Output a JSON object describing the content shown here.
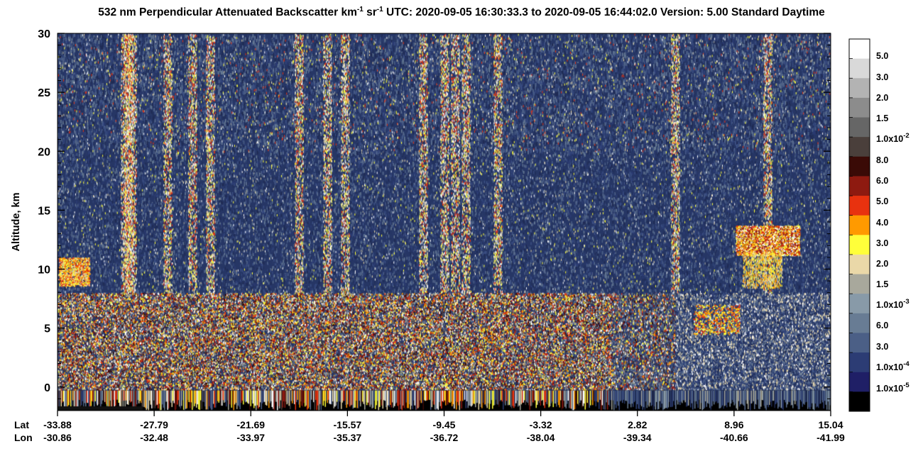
{
  "chart_data": {
    "type": "heatmap",
    "title_prefix": "532 nm Perpendicular Attenuated Backscatter km",
    "title_sup1": "-1",
    "title_mid": " sr",
    "title_sup2": "-1",
    "title_suffix": "  UTC: 2020-09-05 16:30:33.3 to 2020-09-05 16:44:02.0  Version: 5.00 Standard Daytime",
    "ylabel": "Altitude, km",
    "ylim": [
      -2,
      30
    ],
    "y_ticks": [
      "0",
      "5",
      "10",
      "15",
      "20",
      "25",
      "30"
    ],
    "y_tick_values": [
      0,
      5,
      10,
      15,
      20,
      25,
      30
    ],
    "x_row_labels": [
      "Lat",
      "Lon"
    ],
    "lat_ticks": [
      "-33.88",
      "-27.79",
      "-21.69",
      "-15.57",
      "-9.45",
      "-3.32",
      "2.82",
      "8.96",
      "15.04"
    ],
    "lon_ticks": [
      "-30.86",
      "-32.48",
      "-33.97",
      "-35.37",
      "-36.72",
      "-38.04",
      "-39.34",
      "-40.66",
      "-41.99"
    ],
    "tick_fraction": [
      0,
      0.125,
      0.25,
      0.375,
      0.5,
      0.625,
      0.75,
      0.875,
      1
    ],
    "colorbar": {
      "colors": [
        "#ffffff",
        "#d9d9d9",
        "#b3b3b3",
        "#8c8c8c",
        "#666666",
        "#4a3f3b",
        "#3a0a06",
        "#8e1a10",
        "#e8320f",
        "#ff9a00",
        "#ffff3a",
        "#ead8a8",
        "#a8a89c",
        "#889aa8",
        "#687c94",
        "#4b5f86",
        "#2c3c74",
        "#1f1f66",
        "#000000"
      ],
      "labels": [
        {
          "main": "5.0",
          "sup": ""
        },
        {
          "main": "3.0",
          "sup": ""
        },
        {
          "main": "2.0",
          "sup": ""
        },
        {
          "main": "1.5",
          "sup": ""
        },
        {
          "main": "1.0x10",
          "sup": "-2"
        },
        {
          "main": "8.0",
          "sup": ""
        },
        {
          "main": "6.0",
          "sup": ""
        },
        {
          "main": "5.0",
          "sup": ""
        },
        {
          "main": "4.0",
          "sup": ""
        },
        {
          "main": "3.0",
          "sup": ""
        },
        {
          "main": "2.0",
          "sup": ""
        },
        {
          "main": "1.5",
          "sup": ""
        },
        {
          "main": "1.0x10",
          "sup": "-3"
        },
        {
          "main": "6.0",
          "sup": ""
        },
        {
          "main": "3.0",
          "sup": ""
        },
        {
          "main": "1.0x10",
          "sup": "-4"
        },
        {
          "main": "1.0x10",
          "sup": "-5"
        }
      ]
    }
  }
}
